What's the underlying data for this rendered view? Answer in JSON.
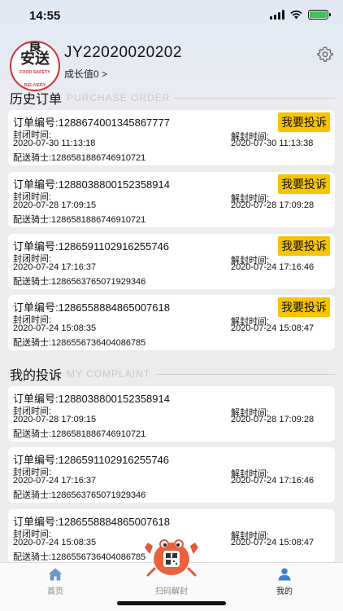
{
  "status_bar": {
    "time": "14:55"
  },
  "profile": {
    "logo_text_1": "食",
    "logo_text_2": "安送",
    "logo_subtext": "FOOD SAFETY DELIVERY",
    "user_id": "JY22020020202",
    "growth_label": "成长值0 >"
  },
  "history_section": {
    "title": "历史订单",
    "subtitle": "PURCHASE ORDER"
  },
  "complaint_section": {
    "title": "我的投诉",
    "subtitle": "MY COMPLAINT"
  },
  "labels": {
    "order_prefix": "订单编号:",
    "seal_time": "封闭时间:",
    "unseal_time": "解封时间:",
    "rider_prefix": "配送骑士:",
    "complain_button": "我要投诉"
  },
  "history_orders": [
    {
      "order": "订单编号:1288674001345867777",
      "seal": "2020-07-30 11:13:18",
      "unseal": "2020-07-30 11:13:38",
      "rider": "配送骑士:1286581886746910721"
    },
    {
      "order": "订单编号:1288038800152358914",
      "seal": "2020-07-28 17:09:15",
      "unseal": "2020-07-28 17:09:28",
      "rider": "配送骑士:1286581886746910721"
    },
    {
      "order": "订单编号:1286591102916255746",
      "seal": "2020-07-24 17:16:37",
      "unseal": "2020-07-24 17:16:46",
      "rider": "配送骑士:1286563765071929346"
    },
    {
      "order": "订单编号:1286558884865007618",
      "seal": "2020-07-24 15:08:35",
      "unseal": "2020-07-24 15:08:47",
      "rider": "配送骑士:1286556736404086785"
    }
  ],
  "complaints": [
    {
      "order": "订单编号:1288038800152358914",
      "seal": "2020-07-28 17:09:15",
      "unseal": "2020-07-28 17:09:28",
      "rider": "配送骑士:1286581886746910721"
    },
    {
      "order": "订单编号:1286591102916255746",
      "seal": "2020-07-24 17:16:37",
      "unseal": "2020-07-24 17:16:46",
      "rider": "配送骑士:1286563765071929346"
    },
    {
      "order": "订单编号:1286558884865007618",
      "seal": "2020-07-24 15:08:35",
      "unseal": "2020-07-24 15:08:47",
      "rider": "配送骑士:1286556736404086785"
    }
  ],
  "tabbar": {
    "home": "首页",
    "scan": "扫码解封",
    "mine": "我的"
  },
  "colors": {
    "accent_yellow": "#f8c400",
    "active_tab": "#3a7fd5",
    "inactive_tab": "#9aa7b4"
  },
  "icons": {
    "settings": "gear-icon",
    "home": "home-icon",
    "scan": "qr-scan-icon",
    "mine": "person-icon"
  }
}
